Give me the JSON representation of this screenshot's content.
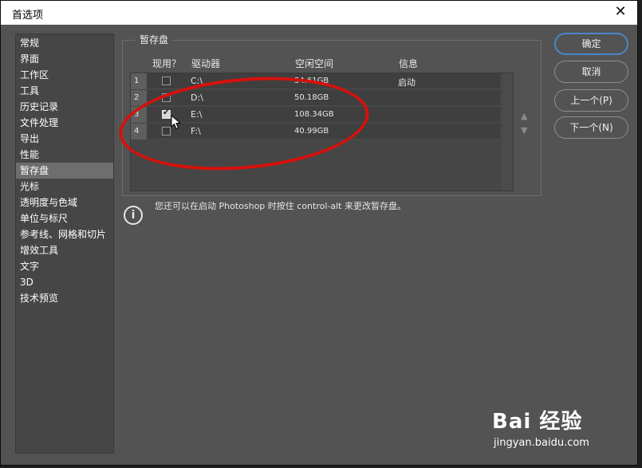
{
  "window": {
    "title": "首选项",
    "close_glyph": "✕"
  },
  "sidebar": {
    "items": [
      {
        "label": "常规"
      },
      {
        "label": "界面"
      },
      {
        "label": "工作区"
      },
      {
        "label": "工具"
      },
      {
        "label": "历史记录"
      },
      {
        "label": "文件处理"
      },
      {
        "label": "导出"
      },
      {
        "label": "性能"
      },
      {
        "label": "暂存盘",
        "active": true
      },
      {
        "label": "光标"
      },
      {
        "label": "透明度与色域"
      },
      {
        "label": "单位与标尺"
      },
      {
        "label": "参考线、网格和切片"
      },
      {
        "label": "增效工具"
      },
      {
        "label": "文字"
      },
      {
        "label": "3D"
      },
      {
        "label": "技术预览"
      }
    ]
  },
  "scratch": {
    "legend": "暂存盘",
    "columns": {
      "active": "现用？",
      "drive": "驱动器",
      "free": "空闲空间",
      "info": "信息"
    },
    "rows": [
      {
        "num": "1",
        "checked": false,
        "drive": "C:\\",
        "free": "54.61GB",
        "info": "启动"
      },
      {
        "num": "2",
        "checked": false,
        "drive": "D:\\",
        "free": "50.18GB",
        "info": ""
      },
      {
        "num": "3",
        "checked": true,
        "drive": "E:\\",
        "free": "108.34GB",
        "info": ""
      },
      {
        "num": "4",
        "checked": false,
        "drive": "F:\\",
        "free": "40.99GB",
        "info": ""
      }
    ],
    "move_up_glyph": "▲",
    "move_down_glyph": "▼"
  },
  "notice": {
    "icon": "info-icon",
    "icon_glyph": "i",
    "text": "您还可以在启动 Photoshop 时按住 control-alt 来更改暂存盘。"
  },
  "buttons": {
    "ok": "确定",
    "cancel": "取消",
    "prev": "上一个(P)",
    "next": "下一个(N)"
  },
  "watermark": {
    "brand": "Bai 经验",
    "url": "jingyan.baidu.com"
  },
  "colors": {
    "panel": "#535353",
    "accent": "#4a86c8",
    "annotation": "#d6110d"
  }
}
